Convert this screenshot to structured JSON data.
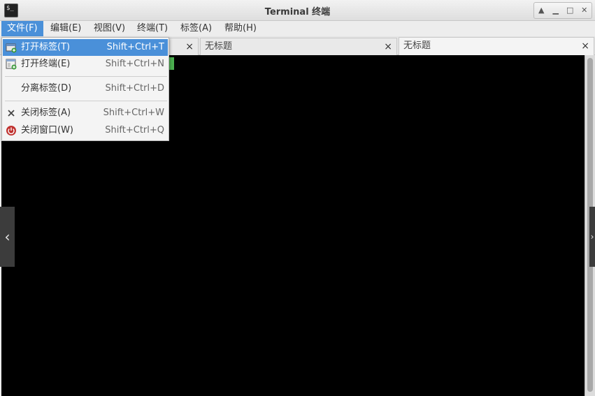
{
  "window": {
    "title": "Terminal 终端",
    "icon": "terminal-icon",
    "buttons": [
      "up-icon",
      "minimize-icon",
      "maximize-icon",
      "close-icon"
    ]
  },
  "menubar": {
    "items": [
      {
        "label": "文件(F)",
        "active": true
      },
      {
        "label": "编辑(E)"
      },
      {
        "label": "视图(V)"
      },
      {
        "label": "终端(T)"
      },
      {
        "label": "标签(A)"
      },
      {
        "label": "帮助(H)"
      }
    ]
  },
  "tabs": [
    {
      "label": "",
      "close": "×"
    },
    {
      "label": "无标题",
      "close": "×"
    },
    {
      "label": "无标题",
      "close": "×",
      "active": true
    }
  ],
  "file_menu": {
    "items": [
      {
        "label": "打开标签(T)",
        "accel": "Shift+Ctrl+T",
        "icon": "new-tab-icon",
        "highlighted": true
      },
      {
        "label": "打开终端(E)",
        "accel": "Shift+Ctrl+N",
        "icon": "new-window-icon"
      },
      {
        "label": "分离标签(D)",
        "accel": "Shift+Ctrl+D",
        "icon": ""
      },
      {
        "label": "关闭标签(A)",
        "accel": "Shift+Ctrl+W",
        "icon": "close-tab-icon"
      },
      {
        "label": "关闭窗口(W)",
        "accel": "Shift+Ctrl+Q",
        "icon": "power-icon"
      }
    ]
  },
  "nav": {
    "left": "‹",
    "right": "›"
  },
  "colors": {
    "highlight": "#4a90d9",
    "terminal_bg": "#000000",
    "cursor": "#4caf50"
  }
}
